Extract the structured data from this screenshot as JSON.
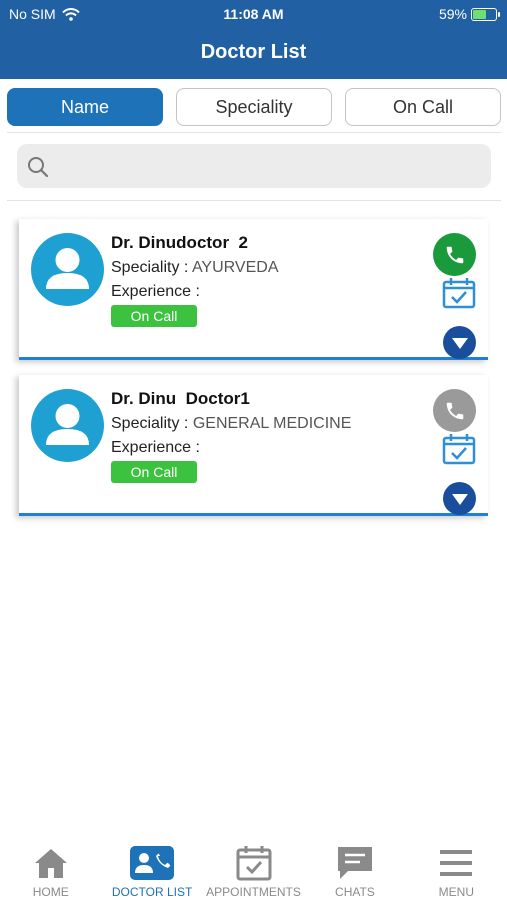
{
  "status_bar": {
    "carrier": "No SIM",
    "time": "11:08 AM",
    "battery": "59%",
    "battery_level": 0.59
  },
  "header": {
    "title": "Doctor List"
  },
  "tabs": [
    {
      "label": "Name",
      "active": true
    },
    {
      "label": "Speciality",
      "active": false
    },
    {
      "label": "On Call",
      "active": false
    }
  ],
  "search": {
    "placeholder": ""
  },
  "doctors": [
    {
      "name": "Dr. Dinudoctor  2",
      "speciality_label": "Speciality :",
      "speciality": "AYURVEDA",
      "experience_label": "Experience :",
      "experience": "",
      "status": "On Call",
      "call_color": "#1a9a3a",
      "call_available": true
    },
    {
      "name": "Dr. Dinu  Doctor1",
      "speciality_label": "Speciality :",
      "speciality": "GENERAL MEDICINE",
      "experience_label": "Experience :",
      "experience": "",
      "status": "On Call",
      "call_color": "#9a9a9a",
      "call_available": false
    }
  ],
  "bottom_nav": [
    {
      "label": "HOME",
      "icon": "home-icon",
      "active": false
    },
    {
      "label": "DOCTOR LIST",
      "icon": "doctor-list-icon",
      "active": true
    },
    {
      "label": "APPOINTMENTS",
      "icon": "calendar-check-icon",
      "active": false
    },
    {
      "label": "CHATS",
      "icon": "chat-icon",
      "active": false
    },
    {
      "label": "MENU",
      "icon": "menu-icon",
      "active": false
    }
  ],
  "colors": {
    "header": "#2160a3",
    "accent": "#1d72b8",
    "badge": "#3dc23f",
    "card_border": "#1f7fd4"
  }
}
